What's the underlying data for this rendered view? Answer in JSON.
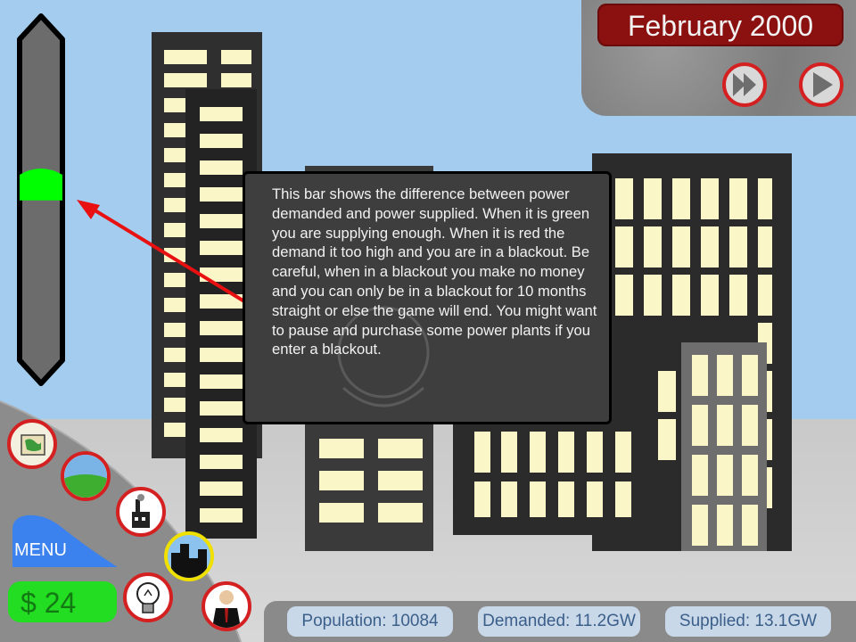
{
  "hud": {
    "date": "February 2000",
    "menu_label": "MENU",
    "money": "$ 24",
    "meter": {
      "supply_fraction": 0.08,
      "status_color": "#00ff00"
    }
  },
  "speed_controls": [
    {
      "name": "fast-forward",
      "icon": "fast-forward-icon"
    },
    {
      "name": "play",
      "icon": "play-icon"
    }
  ],
  "build_buttons": [
    {
      "name": "map",
      "icon": "map-icon"
    },
    {
      "name": "land",
      "icon": "landscape-icon"
    },
    {
      "name": "factory",
      "icon": "factory-icon"
    },
    {
      "name": "city",
      "icon": "city-icon",
      "selected": true
    },
    {
      "name": "lightbulb",
      "icon": "lightbulb-icon"
    },
    {
      "name": "advisor",
      "icon": "businessman-icon"
    }
  ],
  "status": {
    "population": "Population: 10084",
    "demanded": "Demanded: 11.2GW",
    "supplied": "Supplied: 13.1GW"
  },
  "tutorial": {
    "text": "This bar shows the difference between power demanded and power supplied. When it is green you are supplying enough. When it is red the demand it too high and you are in a blackout. Be careful, when in a blackout you make no money and you can only be in a blackout for 10 months straight or else the game will end. You might want to pause and purchase some power plants if you enter a blackout."
  },
  "colors": {
    "sky": "#a3ccee",
    "accent_red": "#d42020",
    "date_box": "#8b1010",
    "money_green": "#22dd22",
    "window": "#fbf6c8",
    "arrow": "#e81010"
  }
}
